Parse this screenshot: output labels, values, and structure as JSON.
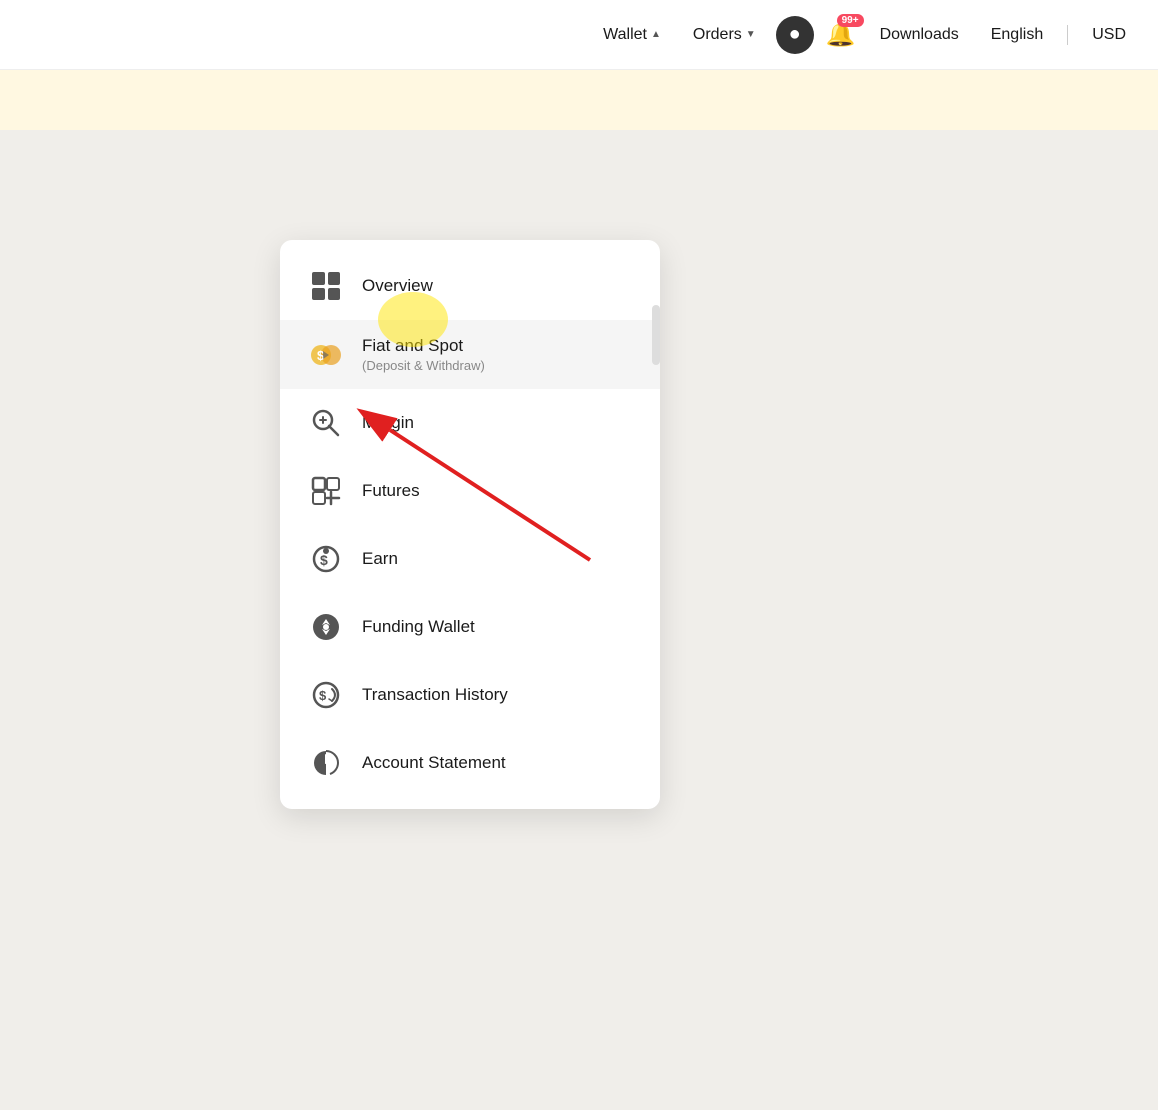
{
  "header": {
    "nav": {
      "wallet_label": "Wallet",
      "orders_label": "Orders",
      "downloads_label": "Downloads",
      "english_label": "English",
      "usd_label": "USD",
      "notification_count": "99+"
    }
  },
  "dropdown": {
    "items": [
      {
        "id": "overview",
        "label": "Overview",
        "sublabel": "",
        "icon": "overview-icon"
      },
      {
        "id": "fiat-spot",
        "label": "Fiat and Spot",
        "sublabel": "(Deposit & Withdraw)",
        "icon": "fiat-spot-icon"
      },
      {
        "id": "margin",
        "label": "Margin",
        "sublabel": "",
        "icon": "margin-icon"
      },
      {
        "id": "futures",
        "label": "Futures",
        "sublabel": "",
        "icon": "futures-icon"
      },
      {
        "id": "earn",
        "label": "Earn",
        "sublabel": "",
        "icon": "earn-icon"
      },
      {
        "id": "funding-wallet",
        "label": "Funding Wallet",
        "sublabel": "",
        "icon": "funding-wallet-icon"
      },
      {
        "id": "transaction-history",
        "label": "Transaction History",
        "sublabel": "",
        "icon": "transaction-history-icon"
      },
      {
        "id": "account-statement",
        "label": "Account Statement",
        "sublabel": "",
        "icon": "account-statement-icon"
      }
    ]
  }
}
